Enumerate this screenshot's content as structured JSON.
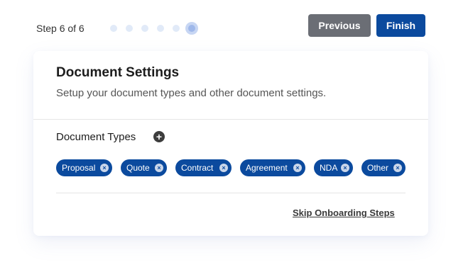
{
  "progress": {
    "step_text": "Step 6 of 6",
    "total_steps": 6,
    "current_step": 6
  },
  "buttons": {
    "previous_label": "Previous",
    "finish_label": "Finish"
  },
  "card": {
    "title": "Document Settings",
    "subtitle": "Setup your document types and other document settings.",
    "section_title": "Document Types",
    "add_icon": "plus-circle-icon",
    "tags": [
      {
        "label": "Proposal"
      },
      {
        "label": "Quote"
      },
      {
        "label": "Contract"
      },
      {
        "label": "Agreement"
      },
      {
        "label": "NDA"
      },
      {
        "label": "Other"
      }
    ],
    "skip_label": "Skip Onboarding Steps"
  },
  "colors": {
    "primary": "#0b4a9e",
    "secondary_button": "#6b6e75",
    "progress_dot": "#e1eaf8",
    "progress_dot_active": "#9fb8ea"
  }
}
